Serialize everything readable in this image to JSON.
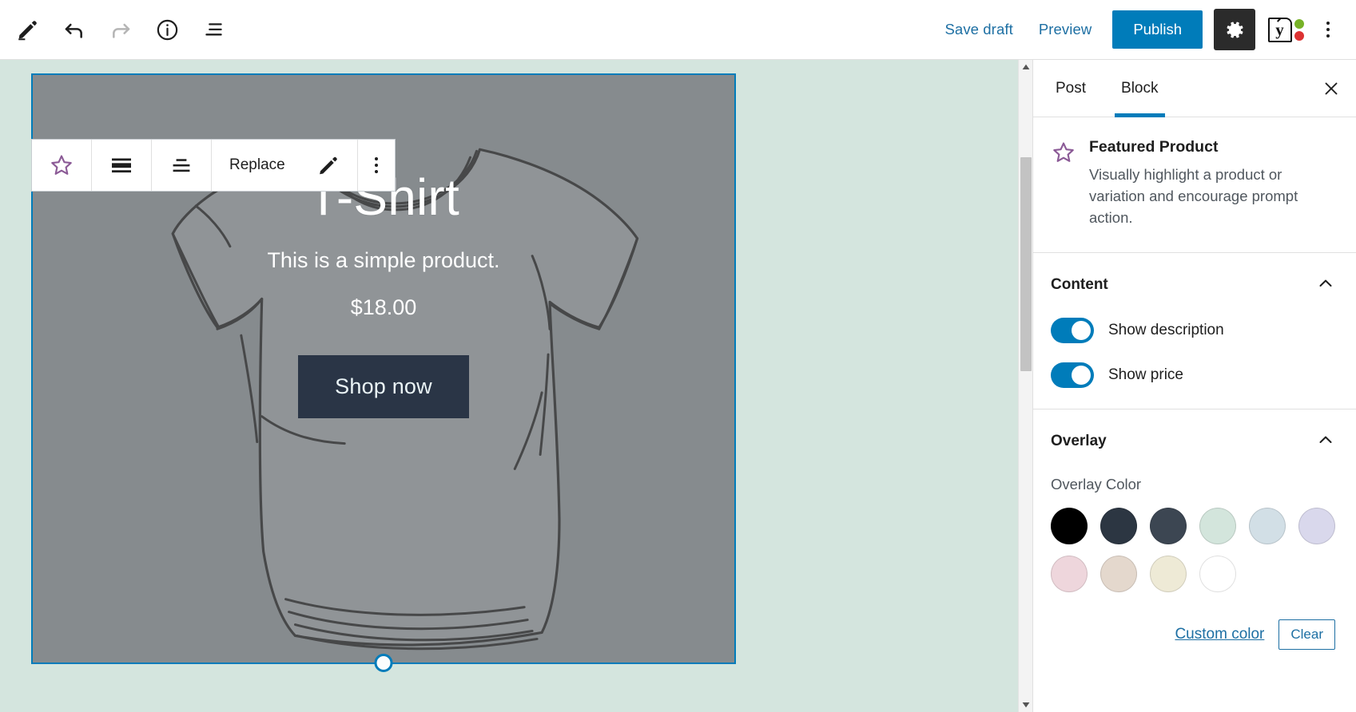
{
  "topbar": {
    "tools": [
      {
        "name": "edit-pen-icon",
        "label": "Edit"
      },
      {
        "name": "undo-icon",
        "label": "Undo"
      },
      {
        "name": "redo-icon",
        "label": "Redo"
      },
      {
        "name": "info-icon",
        "label": "Details"
      },
      {
        "name": "list-view-icon",
        "label": "List view"
      }
    ],
    "save_draft_label": "Save draft",
    "preview_label": "Preview",
    "publish_label": "Publish",
    "settings_icon": "gear-icon",
    "yoast_icon": "yoast-seo-icon",
    "yoast_letter": "y",
    "yoast_dot_green": "#77b227",
    "yoast_dot_red": "#dc3232",
    "more_icon": "kebab-menu-icon",
    "accent_color": "#007cba",
    "link_color": "#1d6fa3"
  },
  "block_toolbar": {
    "block_icon": "star-icon",
    "block_icon_color": "#8b5a96",
    "align_wide_icon": "align-full-width-icon",
    "text_align_icon": "change-alignment-icon",
    "replace_label": "Replace",
    "edit_icon": "pencil-edit-icon",
    "more_icon": "kebab-menu-icon"
  },
  "canvas": {
    "background_color": "#d4e5de",
    "selection_color": "#007cba",
    "block_background": "#8b9093",
    "product": {
      "title": "T-Shirt",
      "description": "This is a simple product.",
      "price": "$18.00",
      "button_label": "Shop now",
      "button_bg": "#2a3546",
      "button_text_color": "#eaf4f6"
    },
    "resize_handle": "bottom-resize-handle"
  },
  "sidebar": {
    "tabs": [
      {
        "label": "Post",
        "active": false
      },
      {
        "label": "Block",
        "active": true
      }
    ],
    "close_icon": "close-icon",
    "block": {
      "icon": "star-icon",
      "icon_color": "#8b5a96",
      "title": "Featured Product",
      "description": "Visually highlight a product or variation and encourage prompt action."
    },
    "content_panel": {
      "title": "Content",
      "collapse_icon": "chevron-up-icon",
      "toggles": [
        {
          "label": "Show description",
          "on": true
        },
        {
          "label": "Show price",
          "on": true
        }
      ]
    },
    "overlay_panel": {
      "title": "Overlay",
      "collapse_icon": "chevron-up-icon",
      "color_label": "Overlay Color",
      "swatches": [
        {
          "name": "black",
          "hex": "#000000"
        },
        {
          "name": "dark-slate",
          "hex": "#2c3642"
        },
        {
          "name": "slate-gray",
          "hex": "#3c4652"
        },
        {
          "name": "pale-mint",
          "hex": "#d3e5dc"
        },
        {
          "name": "pale-blue",
          "hex": "#d2dfe6"
        },
        {
          "name": "pale-lavender",
          "hex": "#d9d8ec"
        },
        {
          "name": "pale-pink",
          "hex": "#eed6dc"
        },
        {
          "name": "pale-tan",
          "hex": "#e4d8cd"
        },
        {
          "name": "pale-cream",
          "hex": "#eeead6"
        },
        {
          "name": "white",
          "hex": "#ffffff"
        }
      ],
      "custom_color_label": "Custom color",
      "clear_label": "Clear"
    }
  }
}
